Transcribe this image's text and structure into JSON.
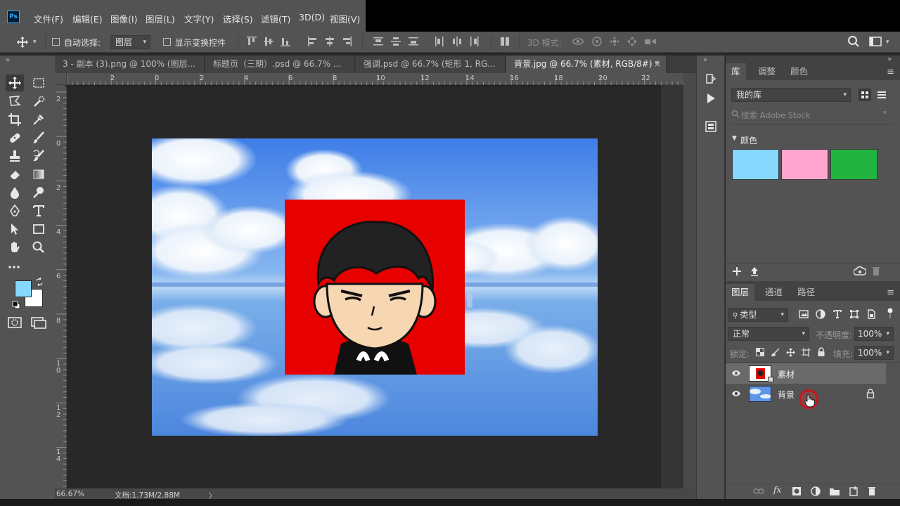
{
  "app": {
    "logo": "Ps",
    "menu": [
      "文件(F)",
      "编辑(E)",
      "图像(I)",
      "图层(L)",
      "文字(Y)",
      "选择(S)",
      "滤镜(T)",
      "3D(D)",
      "视图(V)"
    ]
  },
  "options": {
    "auto_select_label": "自动选择:",
    "auto_select_value": "图层",
    "show_transform_label": "显示变换控件",
    "mode_3d_label": "3D 模式:"
  },
  "tabs": [
    {
      "label": "3 - 副本 (3).png @ 100% (图层..."
    },
    {
      "label": "标题页（三期）.psd @ 66.7% ..."
    },
    {
      "label": "强调.psd @ 66.7% (矩形 1, RG..."
    },
    {
      "label": "背景.jpg @ 66.7% (素材, RGB/8#) *"
    }
  ],
  "tab_close": "×",
  "ruler": {
    "top_ticks": [
      "2",
      "0",
      "2",
      "4",
      "6",
      "8",
      "10",
      "12",
      "14",
      "16",
      "18",
      "20",
      "22"
    ],
    "left_ticks": [
      "2",
      "0",
      "2",
      "4",
      "6",
      "8",
      "1\n0",
      "1\n2",
      "1\n4"
    ]
  },
  "status": {
    "zoom": "66.67%",
    "doc_info": "文档:1.73M/2.88M",
    "arrow": "〉"
  },
  "library_panel": {
    "tabs": [
      "库",
      "调整",
      "颜色"
    ],
    "library_select": "我的库",
    "search_placeholder": "搜索 Adobe Stock",
    "section_title": "颜色",
    "swatches": [
      "#86d8ff",
      "#ffa6cf",
      "#21b440"
    ]
  },
  "layers_panel": {
    "tabs": [
      "图层",
      "通道",
      "路径"
    ],
    "filter_label": "类型",
    "blend_mode": "正常",
    "opacity_label": "不透明度:",
    "opacity_value": "100%",
    "lock_label": "锁定:",
    "fill_label": "填充:",
    "fill_value": "100%",
    "layers": [
      {
        "name": "素材",
        "selected": true
      },
      {
        "name": "背景",
        "selected": false,
        "locked": true
      }
    ]
  },
  "colors": {
    "foreground": "#86d8ff",
    "background": "#ffffff",
    "avatar_bg": "#e60000",
    "accent": "#31a8ff"
  }
}
